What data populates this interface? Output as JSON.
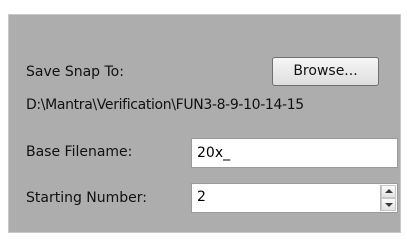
{
  "save_snap": {
    "label": "Save Snap To:",
    "browse_label": "Browse...",
    "path": "D:\\Mantra\\Verification\\FUN3-8-9-10-14-15"
  },
  "base_filename": {
    "label": "Base Filename:",
    "value": "20x_"
  },
  "starting_number": {
    "label": "Starting Number:",
    "value": "2"
  },
  "icons": {
    "spin_up": "chevron-up-icon",
    "spin_down": "chevron-down-icon"
  },
  "colors": {
    "panel_background": "#adadad",
    "button_face": "#e8e8e8",
    "input_background": "#ffffff"
  }
}
